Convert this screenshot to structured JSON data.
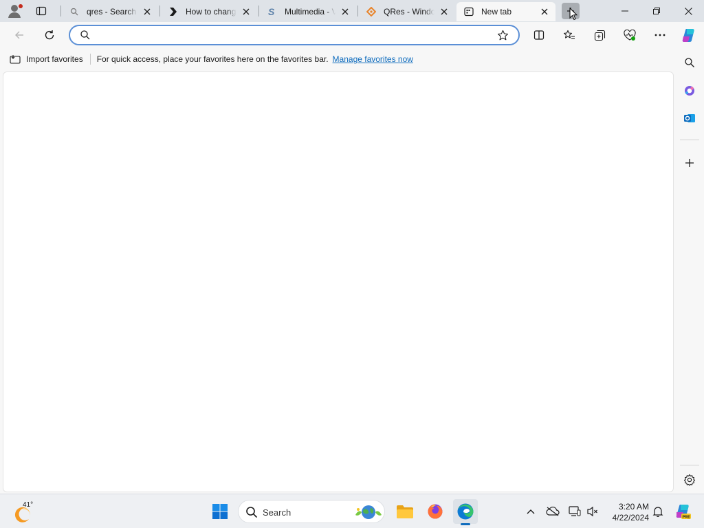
{
  "tabs": [
    {
      "label": "qres - Search",
      "icon": "search-icon",
      "close": "close-icon"
    },
    {
      "label": "How to change",
      "icon": "chevron-logo-icon",
      "close": "close-icon"
    },
    {
      "label": "Multimedia - V",
      "icon": "s-logo-icon",
      "close": "close-icon"
    },
    {
      "label": "QRes - Window",
      "icon": "diamond-logo-icon",
      "close": "close-icon"
    },
    {
      "label": "New tab",
      "icon": "newtab-icon",
      "close": "close-icon",
      "active": true
    }
  ],
  "address": {
    "value": "",
    "placeholder": ""
  },
  "favorites_bar": {
    "import_label": "Import favorites",
    "hint": "For quick access, place your favorites here on the favorites bar.",
    "manage_link": "Manage favorites now"
  },
  "taskbar": {
    "weather_temp": "41°",
    "search_label": "Search",
    "time": "3:20 AM",
    "date": "4/22/2024"
  },
  "colors": {
    "accent": "#0f6cbd",
    "tabbar": "#dfe3e8",
    "toolbar": "#f7f7f7"
  }
}
